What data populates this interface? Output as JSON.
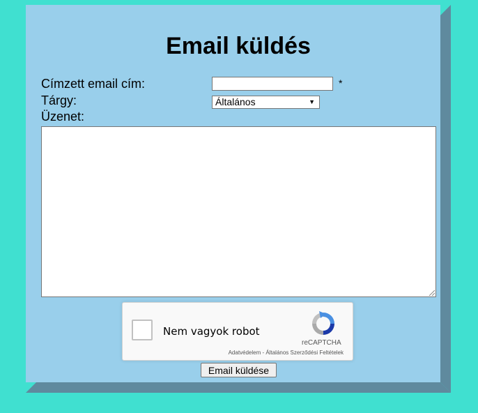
{
  "page": {
    "title": "Email küldés"
  },
  "form": {
    "email_label": "Címzett email cím:",
    "email_value": "",
    "required_marker": "*",
    "subject_label": "Tárgy:",
    "subject_selected": "Általános",
    "message_label": "Üzenet:",
    "message_value": "",
    "submit_label": "Email küldése"
  },
  "captcha": {
    "checkbox_label": "Nem vagyok robot",
    "brand": "reCAPTCHA",
    "terms": "Adatvédelem - Általános Szerződési Feltételek"
  },
  "colors": {
    "page_bg": "#40e0d0",
    "card_bg": "#99cfeb",
    "card_bevel": "#5f8a9e"
  },
  "icons": {
    "select_arrow": "dropdown-arrow-icon",
    "captcha_logo": "recaptcha-logo-icon"
  }
}
